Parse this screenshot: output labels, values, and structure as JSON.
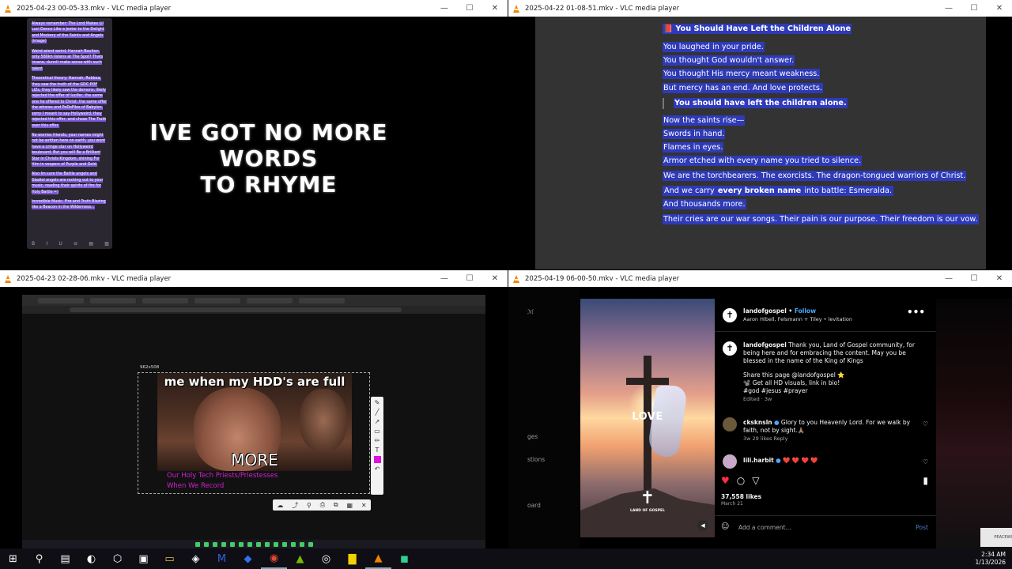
{
  "windows": {
    "w1": {
      "title": "2025-04-23 00-05-33.mkv - VLC media player",
      "notes": [
        "Always remember: The Lord Makes Lil Luci Dance Like a Jester to the Delight and Mockery of the Saints and Angels (image)",
        "Weird wierd weird, Hannah Boulton, only 580kh listens at The Spot? Thats insane, dunnit make sense with such talent",
        "Theoretical theory: Hannah, Robbea, they saw the truth of the GDC POF LIZs, they likely saw the demons, likely rejected the offer of lucifer, the same one he offered to Christ, the same offer the whores and PeDoFiles of Babylon, sorry I meant to say Hollyweird, they rejected this offer, and chose The Truth over this offer.",
        "No worries friends, your names might not be written here on earth, you wont have a cringe star on Hollyweird boulevard, But you will Be a Brilliant Star in Christs Kingdom, shining For Him in vespers of Purple and Gold.",
        "Also Im sure the Battle angels and Gladiel angels are rocking out to your music, reading their spirits of fire for Holy Battle =)",
        "Incredible Music, Fire and Truth Blazing like a Beacon in the Wilderness..."
      ],
      "toolbar": [
        "B",
        "I",
        "U",
        "⊖",
        "▤",
        "▨"
      ],
      "lyric_line1": "IVE GOT NO MORE WORDS",
      "lyric_line2": "TO RHYME"
    },
    "w2": {
      "title": "2025-04-22 01-08-51.mkv - VLC media player",
      "heading": "📕 You Should Have Left the Children Alone",
      "lines_a": [
        "You laughed in your pride.",
        "You thought God wouldn't answer.",
        "You thought His mercy meant weakness."
      ],
      "line_b": "But mercy has an end. And love protects.",
      "quote": "You should have left the children alone.",
      "lines_c": [
        "Now the saints rise—",
        "Swords in hand.",
        "Flames in eyes.",
        "Armor etched with every name you tried to silence."
      ],
      "line_d": "We are the torchbearers. The exorcists. The dragon-tongued warriors of Christ.",
      "line_e_pre": "And we carry ",
      "line_e_bold": "every broken name",
      "line_e_post": " into battle: Esmeralda.",
      "line_f": "And thousands more.",
      "line_g": "Their cries are our war songs. Their pain is our purpose. Their freedom is our vow."
    },
    "w3": {
      "title": "2025-04-23 02-28-06.mkv - VLC media player",
      "dimensions": "962x508",
      "meme_top": "me when my HDD's are full",
      "meme_bottom": "MORE",
      "caption_line1": "Our Holy Tech Priests/Priestesses",
      "caption_line2": "When We Record",
      "vtools": [
        "✎",
        "╱",
        "↗",
        "▭",
        "✏",
        "T",
        "↶"
      ],
      "htools": [
        "☁",
        "⤴",
        "⚲",
        "⎙",
        "⧉",
        "▦",
        "✕"
      ]
    },
    "w4": {
      "title": "2025-04-19 06-00-50.mkv - VLC media player",
      "side": [
        "ℳ",
        "ges",
        "stions",
        "oard"
      ],
      "love": "LOVE",
      "logo_text": "LAND OF GOSPEL",
      "username": "landofgospel",
      "follow": "Follow",
      "song": "Aaron Hibell, Felsmann + Tiley • levitation",
      "caption_user": "landofgospel",
      "caption_text": " Thank you, Land of Gospel community, for being here and for embracing the content. May you be blessed in the name of the King of Kings",
      "caption_share": "Share this page @landofgospel ⭐",
      "caption_get": "📽️ Get all HD visuals, link in bio!",
      "caption_tags": "#god #jesus #prayer",
      "caption_meta": "Edited · 3w",
      "c1_user": "cksknsln",
      "c1_text": " Glory to you Heavenly Lord. For we walk by faith, not by sight.🙏🏽",
      "c1_meta": "3w   29 likes   Reply",
      "c2_user": "lili.harbit",
      "c2_text": " ❤️ ❤️ ❤️ ❤️",
      "likes": "37,558 likes",
      "date": "March 21",
      "add_comment": "Add a comment...",
      "post": "Post",
      "badge": "PEACEWORLD"
    }
  },
  "clock": {
    "time": "2:34 AM",
    "date": "1/13/2026"
  },
  "taskbar": [
    "⊞",
    "⚲",
    "▤",
    "◐",
    "⬡",
    "▣",
    "▭",
    "◈",
    "M",
    "◆",
    "◉",
    "▲",
    "◎",
    "▇",
    "▲",
    "◼"
  ]
}
